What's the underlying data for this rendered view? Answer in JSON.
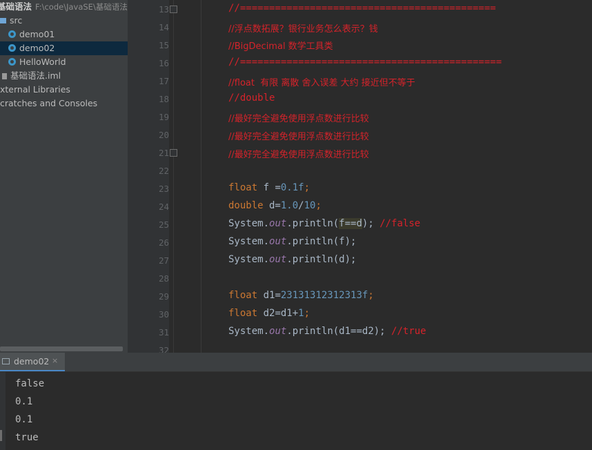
{
  "project": {
    "root_name": "基础语法",
    "root_path": "F:\\code\\JavaSE\\基础语法",
    "items": [
      {
        "label": "src",
        "kind": "folder"
      },
      {
        "label": "demo01",
        "kind": "class"
      },
      {
        "label": "demo02",
        "kind": "class",
        "selected": true
      },
      {
        "label": "HelloWorld",
        "kind": "class"
      },
      {
        "label": "基础语法.iml",
        "kind": "file"
      },
      {
        "label": "xternal Libraries",
        "kind": "library"
      },
      {
        "label": "cratches and Consoles",
        "kind": "scratch"
      }
    ]
  },
  "editor": {
    "line_numbers": [
      "13",
      "14",
      "15",
      "16",
      "17",
      "18",
      "19",
      "20",
      "21",
      "22",
      "23",
      "24",
      "25",
      "26",
      "27",
      "28",
      "29",
      "30",
      "31",
      "32"
    ],
    "comments": {
      "l13": "//============================================",
      "l14": "//浮点数拓展？银行业务怎么表示？钱",
      "l15": "//BigDecimal 数学工具类",
      "l16": "//=============================================",
      "l17": "//float  有限 离散 舍入误差 大约 接近但不等于",
      "l18": "//double",
      "l19": "//最好完全避免使用浮点数进行比较",
      "l20": "//最好完全避免使用浮点数进行比较",
      "l21": "//最好完全避免使用浮点数进行比较"
    },
    "code": {
      "l23": {
        "kw": "float",
        "rest": " f =",
        "num": "0.1f",
        "end": ";"
      },
      "l24": {
        "kw": "double",
        "rest": " d=",
        "num1": "1.0",
        "op": "/",
        "num2": "10",
        "end": ";"
      },
      "l25": {
        "obj": "System.",
        "fld": "out",
        "call": ".println(",
        "hl": "f==d",
        "end": "); ",
        "cmt": "//false"
      },
      "l26": {
        "obj": "System.",
        "fld": "out",
        "call": ".println(f);"
      },
      "l27": {
        "obj": "System.",
        "fld": "out",
        "call": ".println(d);"
      },
      "l29": {
        "kw": "float",
        "rest": " d1=",
        "num": "23131312312313f",
        "end": ";"
      },
      "l30": {
        "kw": "float",
        "rest": " d2=d1+",
        "num": "1",
        "end": ";"
      },
      "l31": {
        "obj": "System.",
        "fld": "out",
        "call": ".println(d1==d2); ",
        "cmt": "//true"
      }
    }
  },
  "run": {
    "tab_label": "demo02",
    "close_glyph": "×",
    "output": [
      "false",
      "0.1",
      "0.1",
      "true"
    ]
  },
  "colors": {
    "comment": "#d5232b",
    "keyword": "#cc7832",
    "number": "#6897bb",
    "field": "#9876aa",
    "selection": "#0d293e"
  }
}
